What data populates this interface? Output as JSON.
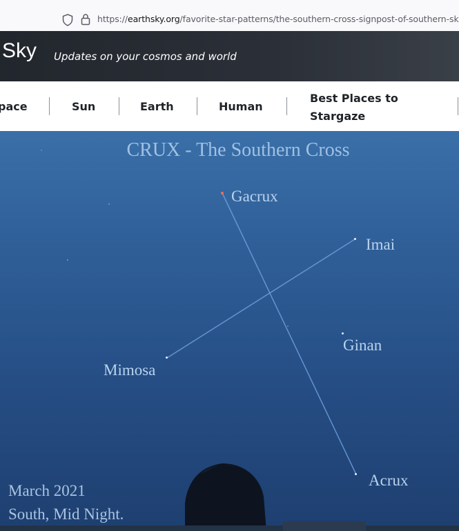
{
  "browser": {
    "url_prefix": "https://",
    "url_domain": "earthsky.org",
    "url_path": "/favorite-star-patterns/the-southern-cross-signpost-of-southern-sk"
  },
  "site": {
    "logo": "Sky",
    "tagline": "Updates on your cosmos and world"
  },
  "nav": {
    "items": [
      {
        "label": "pace"
      },
      {
        "label": "Sun"
      },
      {
        "label": "Earth"
      },
      {
        "label": "Human"
      },
      {
        "label_line1": "Best Places to",
        "label_line2": "Stargaze"
      }
    ]
  },
  "image": {
    "title": "CRUX - The Southern Cross",
    "stars": [
      "Gacrux",
      "Imai",
      "Ginan",
      "Mimosa",
      "Acrux"
    ],
    "caption_line1": "March 2021",
    "caption_line2": "South, Mid Night."
  }
}
